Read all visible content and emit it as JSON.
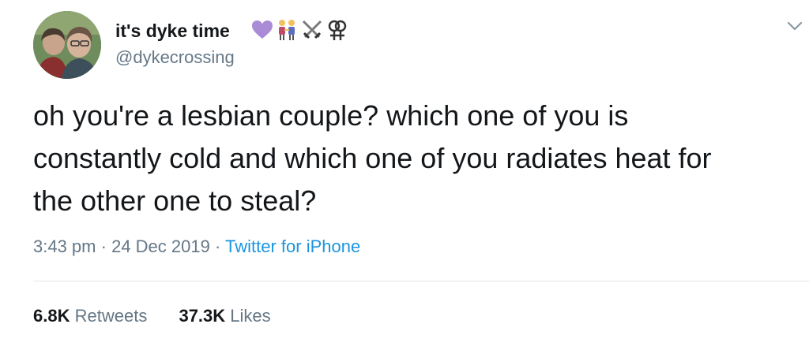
{
  "author": {
    "display_name": "it's dyke time",
    "handle": "@dykecrossing",
    "name_emojis": [
      "purple-heart-icon",
      "women-holding-hands-icon",
      "crossed-swords-icon",
      "lesbian-symbol-icon"
    ]
  },
  "tweet": {
    "text_lines": [
      "oh you're a lesbian couple? which one of you is",
      "constantly cold and which one of you radiates heat for",
      "the other one to steal?"
    ],
    "time": "3:43 pm",
    "separator": "·",
    "date": "24 Dec 2019",
    "source": "Twitter for iPhone"
  },
  "stats": {
    "retweets_count": "6.8K",
    "retweets_label": "Retweets",
    "likes_count": "37.3K",
    "likes_label": "Likes"
  },
  "colors": {
    "text": "#14171a",
    "secondary": "#657786",
    "link": "#1b95e0",
    "divider": "#e1e8ed",
    "heart": "#a98bd6"
  }
}
